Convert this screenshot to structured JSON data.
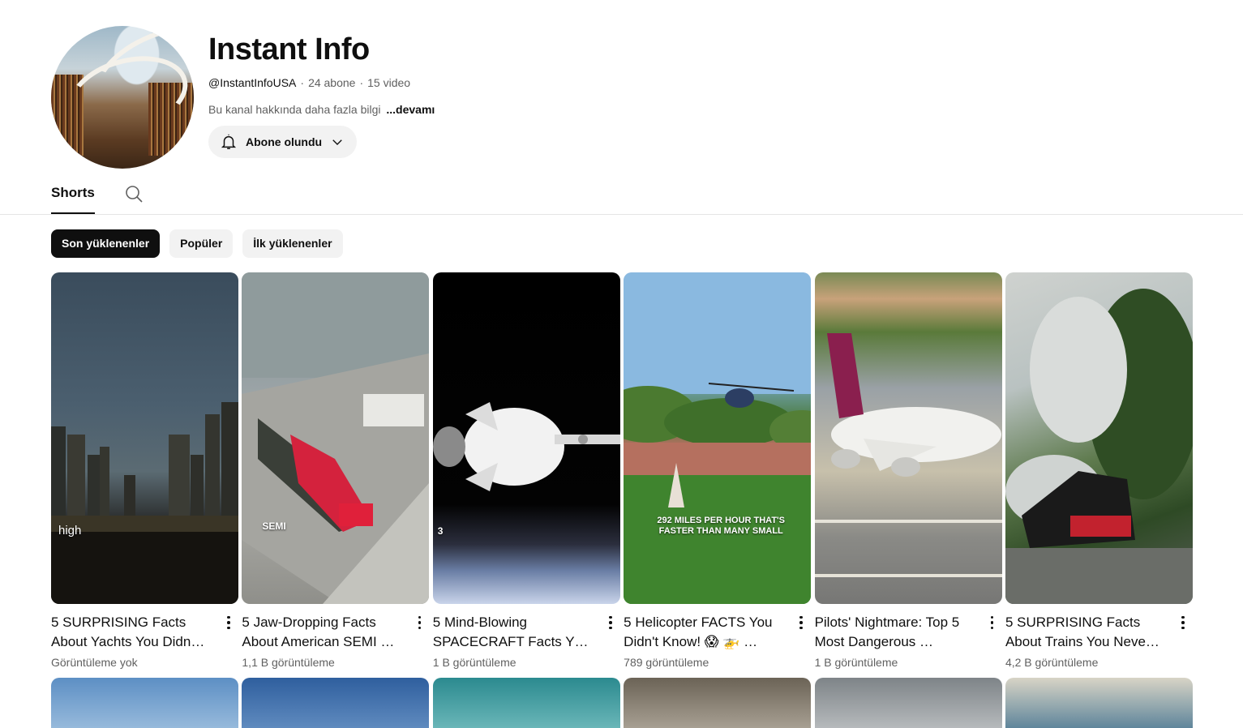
{
  "channel": {
    "name": "Instant Info",
    "handle": "@InstantInfoUSA",
    "subscribers": "24 abone",
    "videos": "15 video",
    "description": "Bu kanal hakkında daha fazla bilgi",
    "more_label": "...devamı",
    "subscribe_label": "Abone olundu"
  },
  "tabs": [
    {
      "label": "Shorts",
      "active": true
    }
  ],
  "chips": [
    {
      "label": "Son yüklenenler",
      "active": true
    },
    {
      "label": "Popüler",
      "active": false
    },
    {
      "label": "İlk yüklenenler",
      "active": false
    }
  ],
  "shorts": [
    {
      "title": "5 SURPRISING Facts About Yachts You Didn…",
      "views": "Görüntüleme yok",
      "overlay": "high"
    },
    {
      "title": "5 Jaw-Dropping Facts About American SEMI …",
      "views": "1,1 B görüntüleme",
      "overlay": "SEMI"
    },
    {
      "title": "5 Mind-Blowing SPACECRAFT Facts Y…",
      "views": "1 B görüntüleme",
      "overlay": "3"
    },
    {
      "title": "5 Helicopter FACTS You Didn't Know! 😱 🚁 …",
      "views": "789 görüntüleme",
      "overlay": "292 MILES PER HOUR THAT'S FASTER THAN MANY SMALL"
    },
    {
      "title": "Pilots' Nightmare: Top 5 Most Dangerous …",
      "views": "1 B görüntüleme",
      "overlay": ""
    },
    {
      "title": "5 SURPRISING Facts About Trains You Neve…",
      "views": "4,2 B görüntüleme",
      "overlay": ""
    }
  ],
  "colors": {
    "accent": "#0f0f0f",
    "chip_bg": "#f2f2f2",
    "secondary_text": "#606060"
  },
  "icons": {
    "bell": "bell-icon",
    "chevron": "chevron-down-icon",
    "search": "search-icon",
    "more": "more-vert-icon"
  }
}
